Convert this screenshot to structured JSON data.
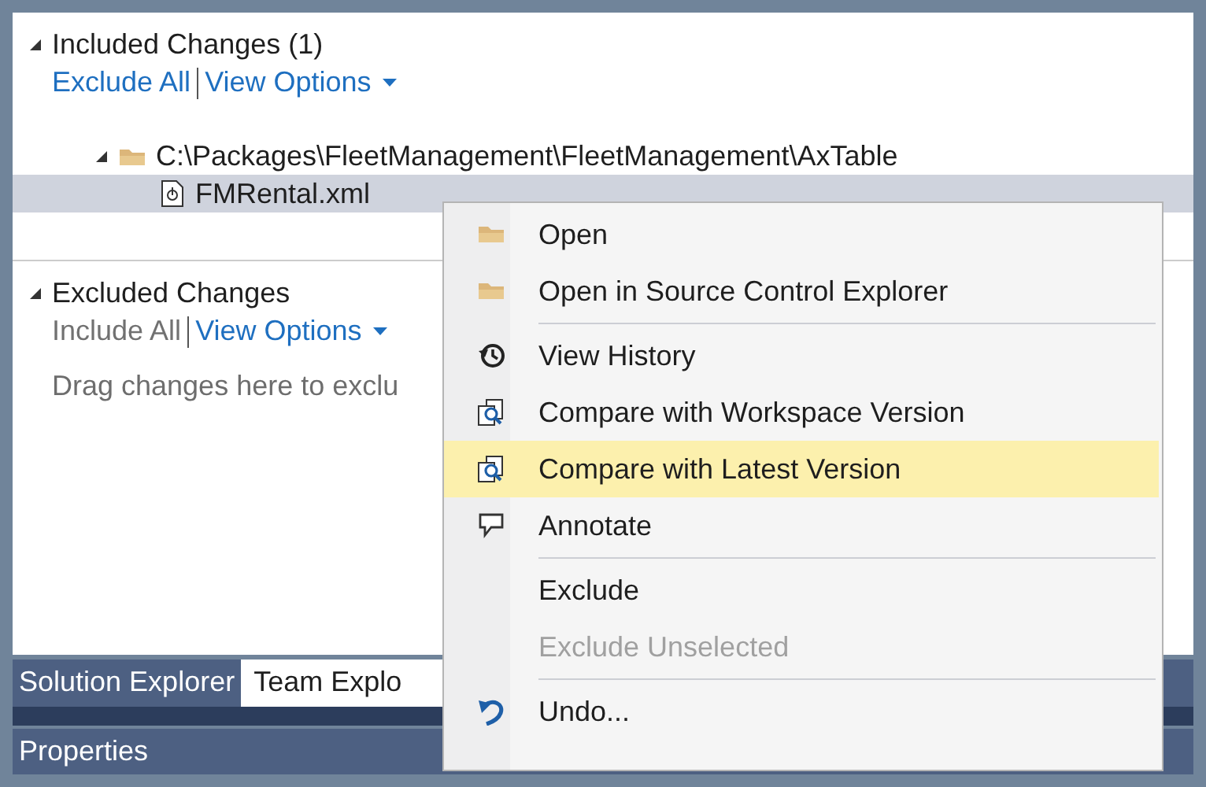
{
  "sections": [
    {
      "title": "Included Changes (1)",
      "expanded": true,
      "links": [
        {
          "label": "Exclude All",
          "disabled": false,
          "has_menu": false
        },
        {
          "label": "View Options",
          "disabled": false,
          "has_menu": true
        }
      ],
      "tree": [
        {
          "kind": "folder",
          "label": "C:\\Packages\\FleetManagement\\FleetManagement\\AxTable",
          "expanded": true,
          "selected": false,
          "children": [
            {
              "kind": "file",
              "label": "FMRental.xml",
              "selected": true
            }
          ]
        }
      ]
    },
    {
      "title": "Excluded Changes",
      "expanded": true,
      "links": [
        {
          "label": "Include All",
          "disabled": true,
          "has_menu": false
        },
        {
          "label": "View Options",
          "disabled": false,
          "has_menu": true
        }
      ],
      "hint": "Drag changes here to exclu"
    }
  ],
  "tabs": [
    {
      "label": "Solution Explorer",
      "selected": false
    },
    {
      "label": "Team Explo",
      "selected": true
    }
  ],
  "properties": {
    "title": "Properties"
  },
  "context_menu": {
    "items": [
      {
        "kind": "item",
        "label": "Open",
        "selected": false,
        "disabled": false
      },
      {
        "kind": "item",
        "label": "Open in Source Control Explorer",
        "selected": false,
        "disabled": false
      },
      {
        "kind": "separator"
      },
      {
        "kind": "item",
        "label": "View History",
        "selected": false,
        "disabled": false
      },
      {
        "kind": "item",
        "label": "Compare with Workspace Version",
        "selected": false,
        "disabled": false
      },
      {
        "kind": "item",
        "label": "Compare with Latest Version",
        "selected": true,
        "disabled": false
      },
      {
        "kind": "item",
        "label": "Annotate",
        "selected": false,
        "disabled": false
      },
      {
        "kind": "separator"
      },
      {
        "kind": "item",
        "label": "Exclude",
        "selected": false,
        "disabled": false
      },
      {
        "kind": "item",
        "label": "Exclude Unselected",
        "selected": false,
        "disabled": true
      },
      {
        "kind": "separator"
      },
      {
        "kind": "item",
        "label": "Undo...",
        "selected": false,
        "disabled": false
      }
    ]
  }
}
